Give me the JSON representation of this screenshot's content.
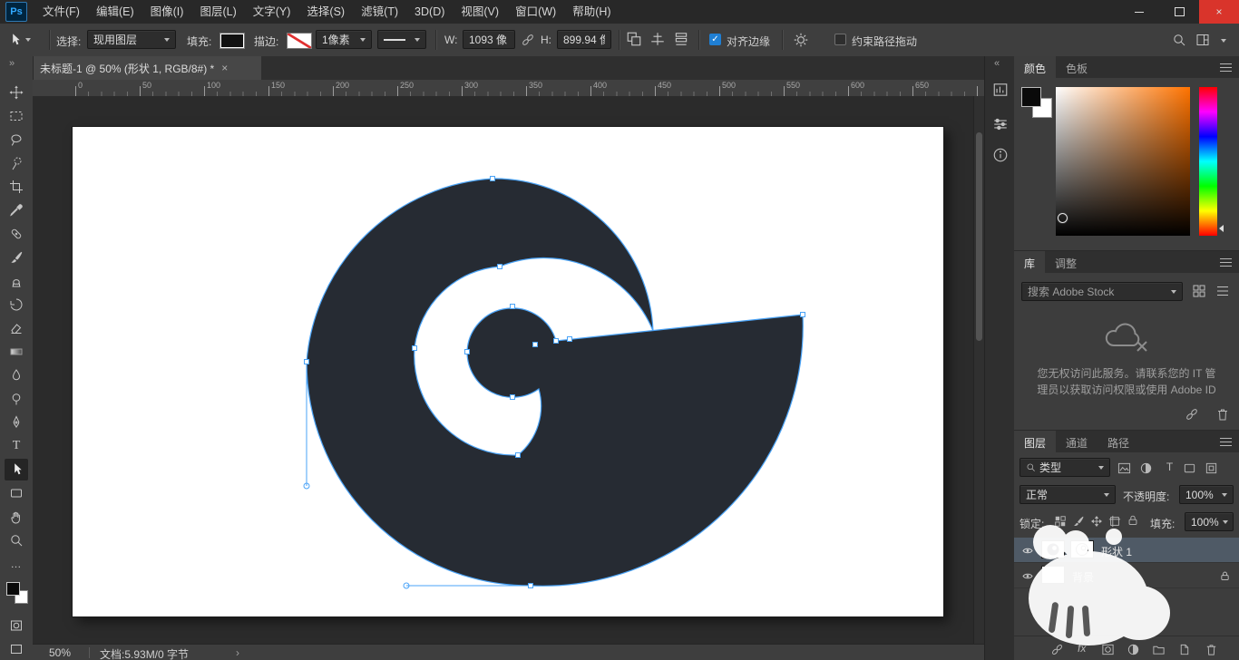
{
  "icons": {
    "check": "✓",
    "close": "×",
    "type": "T",
    "ellipsis": "…",
    "collapse_left": "«",
    "collapse_right": "»",
    "chevron": "›",
    "fx": "fx"
  },
  "menubar": {
    "logo": "Ps",
    "items": [
      "文件(F)",
      "编辑(E)",
      "图像(I)",
      "图层(L)",
      "文字(Y)",
      "选择(S)",
      "滤镜(T)",
      "3D(D)",
      "视图(V)",
      "窗口(W)",
      "帮助(H)"
    ]
  },
  "options": {
    "select_label": "选择:",
    "select_value": "现用图层",
    "fill_label": "填充:",
    "stroke_label": "描边:",
    "stroke_width": "1像素",
    "w_label": "W:",
    "w_value": "1093 像",
    "h_label": "H:",
    "h_value": "899.94 像",
    "align_edges_label": "对齐边缘",
    "constrain_label": "约束路径拖动"
  },
  "document_tab": {
    "title": "未标题-1 @ 50% (形状 1, RGB/8#) *"
  },
  "ruler": {
    "ticks": [
      "0",
      "50",
      "100",
      "150",
      "200",
      "250",
      "300",
      "350",
      "400",
      "450",
      "500",
      "550",
      "600",
      "650"
    ]
  },
  "color_panel": {
    "tabs": [
      "颜色",
      "色板"
    ]
  },
  "library_panel": {
    "tabs": [
      "库",
      "调整"
    ],
    "search_placeholder": "搜索 Adobe Stock",
    "error_line1": "您无权访问此服务。请联系您的 IT 管",
    "error_line2": "理员以获取访问权限或使用 Adobe ID"
  },
  "layers_panel": {
    "tabs": [
      "图层",
      "通道",
      "路径"
    ],
    "filter_label": "类型",
    "blend_mode": "正常",
    "opacity_label": "不透明度:",
    "opacity_value": "100%",
    "lock_label": "锁定:",
    "fill_label": "填充:",
    "fill_value": "100%",
    "layers": [
      {
        "name": "形状 1"
      },
      {
        "name": "背景"
      }
    ]
  },
  "statusbar": {
    "zoom": "50%",
    "doc": "文档:5.93M/0 字节"
  }
}
